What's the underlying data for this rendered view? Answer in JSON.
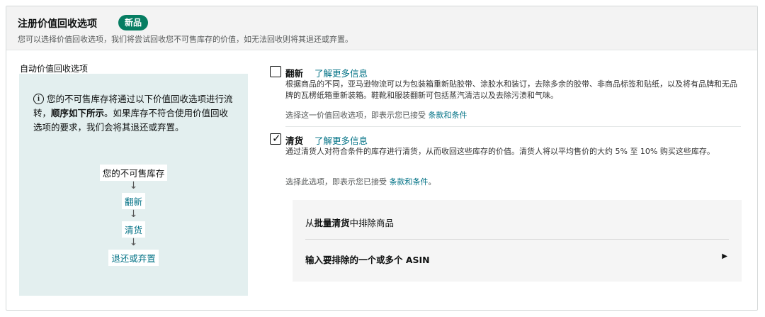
{
  "header": {
    "title": "注册价值回收选项",
    "badge": "新品",
    "subtitle": "您可以选择价值回收选项，我们将尝试回收您不可售库存的价值，如无法回收则将其退还或弃置。"
  },
  "left": {
    "label": "自动价值回收选项",
    "info": {
      "icon": "info-icon",
      "text_part1": "您的不可售库存将通过以下价值回收选项进行流转，",
      "text_bold": "顺序如下所示",
      "text_part2": "。如果库存不符合使用价值回收选项的要求，我们会将其退还或弃置。"
    },
    "flow": [
      "您的不可售库存",
      "翻新",
      "清货",
      "退还或弃置"
    ],
    "arrow": "↓"
  },
  "options": [
    {
      "title": "翻新",
      "link": "了解更多信息",
      "checked": false,
      "description": "根据商品的不同，亚马逊物流可以为包装箱重新贴胶带、涂胶水和装订，去除多余的胶带、非商品标签和贴纸，以及将有品牌和无品牌的瓦楞纸箱重新装箱。鞋靴和服装翻新可包括蒸汽清洁以及去除污渍和气味。",
      "terms_prefix": "选择这一价值回收选项，即表示您已接受 ",
      "terms_link": "条款和条件"
    },
    {
      "title": "清货",
      "link": "了解更多信息",
      "checked": true,
      "description": "通过清货人对符合条件的库存进行清货，从而收回这些库存的价值。清货人将以平均售价的大约 5% 至 10% 购买这些库存。",
      "terms_prefix": "选择此选项，即表示您已接受 ",
      "terms_link": "条款和条件",
      "terms_suffix": "。"
    }
  ],
  "exclude": {
    "prefix": "从",
    "bold": "批量清货",
    "suffix": "中排除商品",
    "asin_label": "输入要排除的一个或多个 ASIN",
    "caret_icon": "caret-right-icon"
  }
}
